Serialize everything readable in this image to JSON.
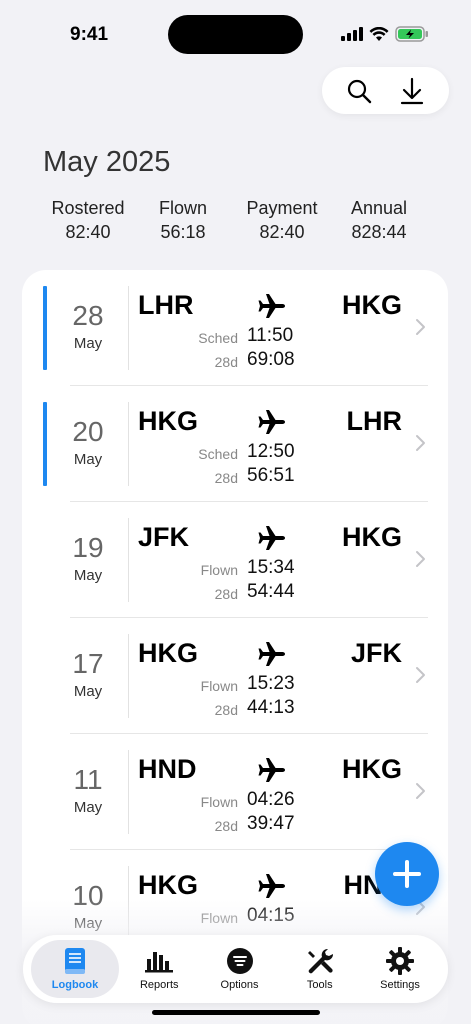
{
  "status": {
    "time": "9:41"
  },
  "header": {
    "month": "May 2025"
  },
  "summary": [
    {
      "label": "Rostered",
      "value": "82:40"
    },
    {
      "label": "Flown",
      "value": "56:18"
    },
    {
      "label": "Payment",
      "value": "82:40"
    },
    {
      "label": "Annual",
      "value": "828:44"
    }
  ],
  "flights": [
    {
      "day": "28",
      "month": "May",
      "from": "LHR",
      "to": "HKG",
      "kind": "Sched",
      "time": "11:50",
      "dlabel": "28d",
      "total": "69:08",
      "accent": true
    },
    {
      "day": "20",
      "month": "May",
      "from": "HKG",
      "to": "LHR",
      "kind": "Sched",
      "time": "12:50",
      "dlabel": "28d",
      "total": "56:51",
      "accent": true
    },
    {
      "day": "19",
      "month": "May",
      "from": "JFK",
      "to": "HKG",
      "kind": "Flown",
      "time": "15:34",
      "dlabel": "28d",
      "total": "54:44",
      "accent": false
    },
    {
      "day": "17",
      "month": "May",
      "from": "HKG",
      "to": "JFK",
      "kind": "Flown",
      "time": "15:23",
      "dlabel": "28d",
      "total": "44:13",
      "accent": false
    },
    {
      "day": "11",
      "month": "May",
      "from": "HND",
      "to": "HKG",
      "kind": "Flown",
      "time": "04:26",
      "dlabel": "28d",
      "total": "39:47",
      "accent": false
    },
    {
      "day": "10",
      "month": "May",
      "from": "HKG",
      "to": "HND",
      "kind": "Flown",
      "time": "04:15",
      "dlabel": "",
      "total": "",
      "accent": false
    }
  ],
  "tabs": [
    {
      "label": "Logbook",
      "icon": "logbook-icon",
      "active": true
    },
    {
      "label": "Reports",
      "icon": "bar-chart-icon",
      "active": false
    },
    {
      "label": "Options",
      "icon": "options-icon",
      "active": false
    },
    {
      "label": "Tools",
      "icon": "wrench-icon",
      "active": false
    },
    {
      "label": "Settings",
      "icon": "gear-icon",
      "active": false
    }
  ],
  "colors": {
    "accent": "#1e88f0",
    "background": "#f2f2f6"
  }
}
